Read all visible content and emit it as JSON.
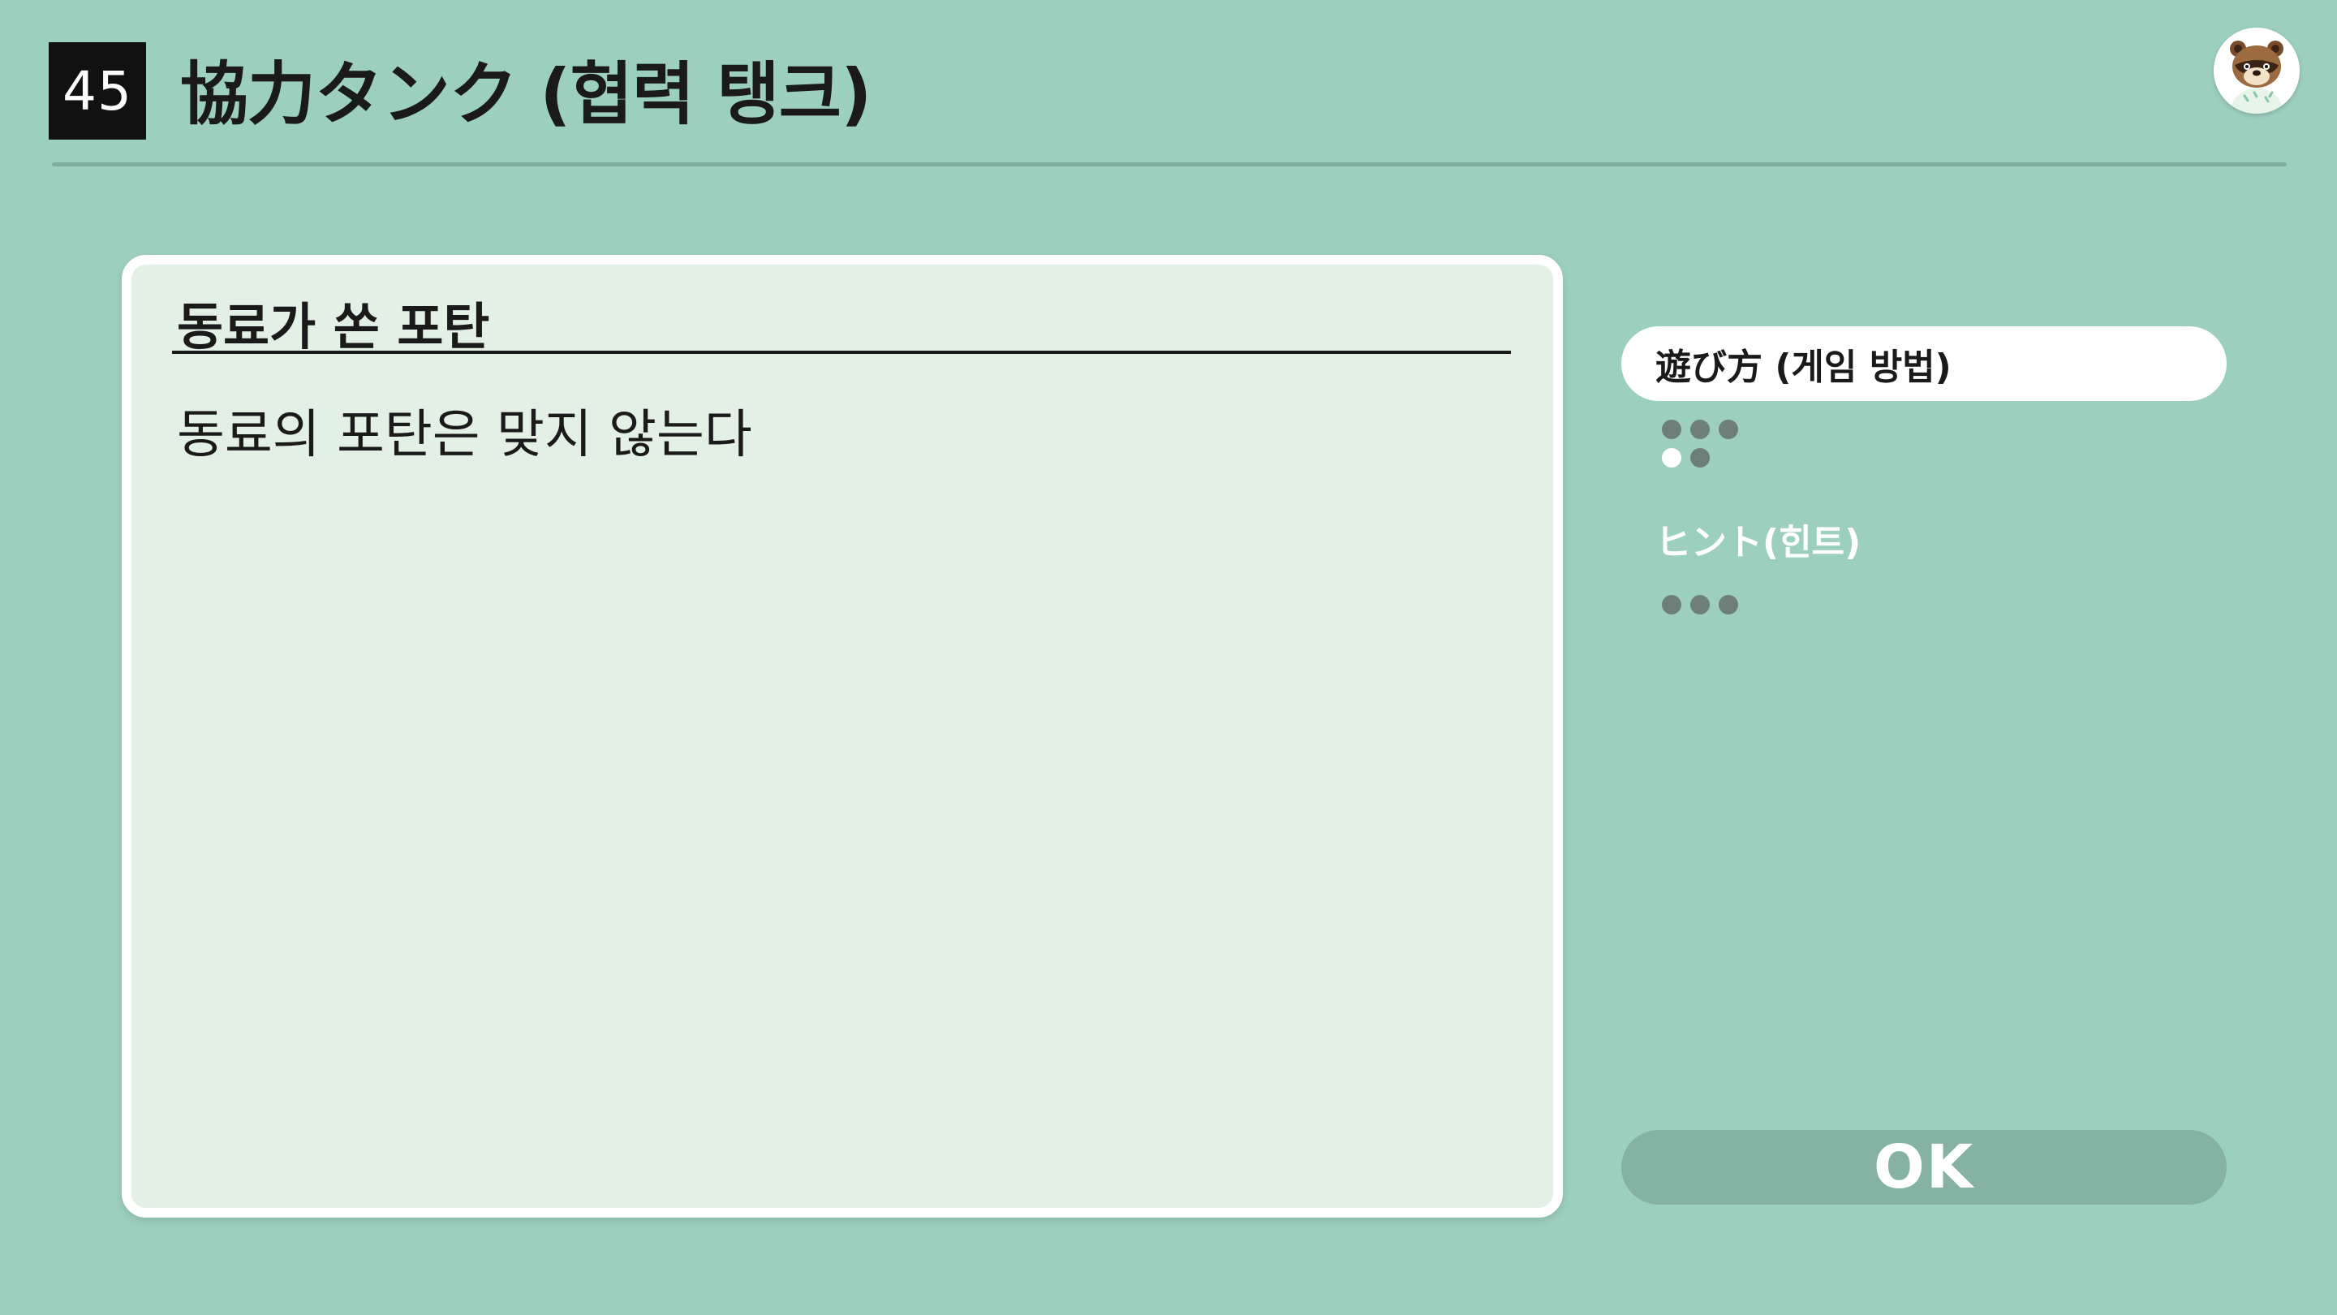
{
  "header": {
    "game_number": "45",
    "title": "協力タンク (협력 탱크)",
    "avatar_icon": "tom-nook-avatar-icon"
  },
  "card": {
    "heading": "동료가 쏜 포탄",
    "body": "동료의 포탄은 맞지 않는다"
  },
  "sidebar": {
    "tabs": [
      {
        "label": "遊び方 (게임 방법)",
        "active": true,
        "progress_dots_total": 5,
        "progress_dots_current": 4
      },
      {
        "label": "ヒント(힌트)",
        "active": false,
        "progress_dots_total": 3
      }
    ]
  },
  "ok_button": {
    "label": "OK"
  },
  "colors": {
    "background": "#9dcfbf",
    "card": "#e2f0e6",
    "ok_button": "#85b2a3",
    "dot": "#6e7f78"
  }
}
